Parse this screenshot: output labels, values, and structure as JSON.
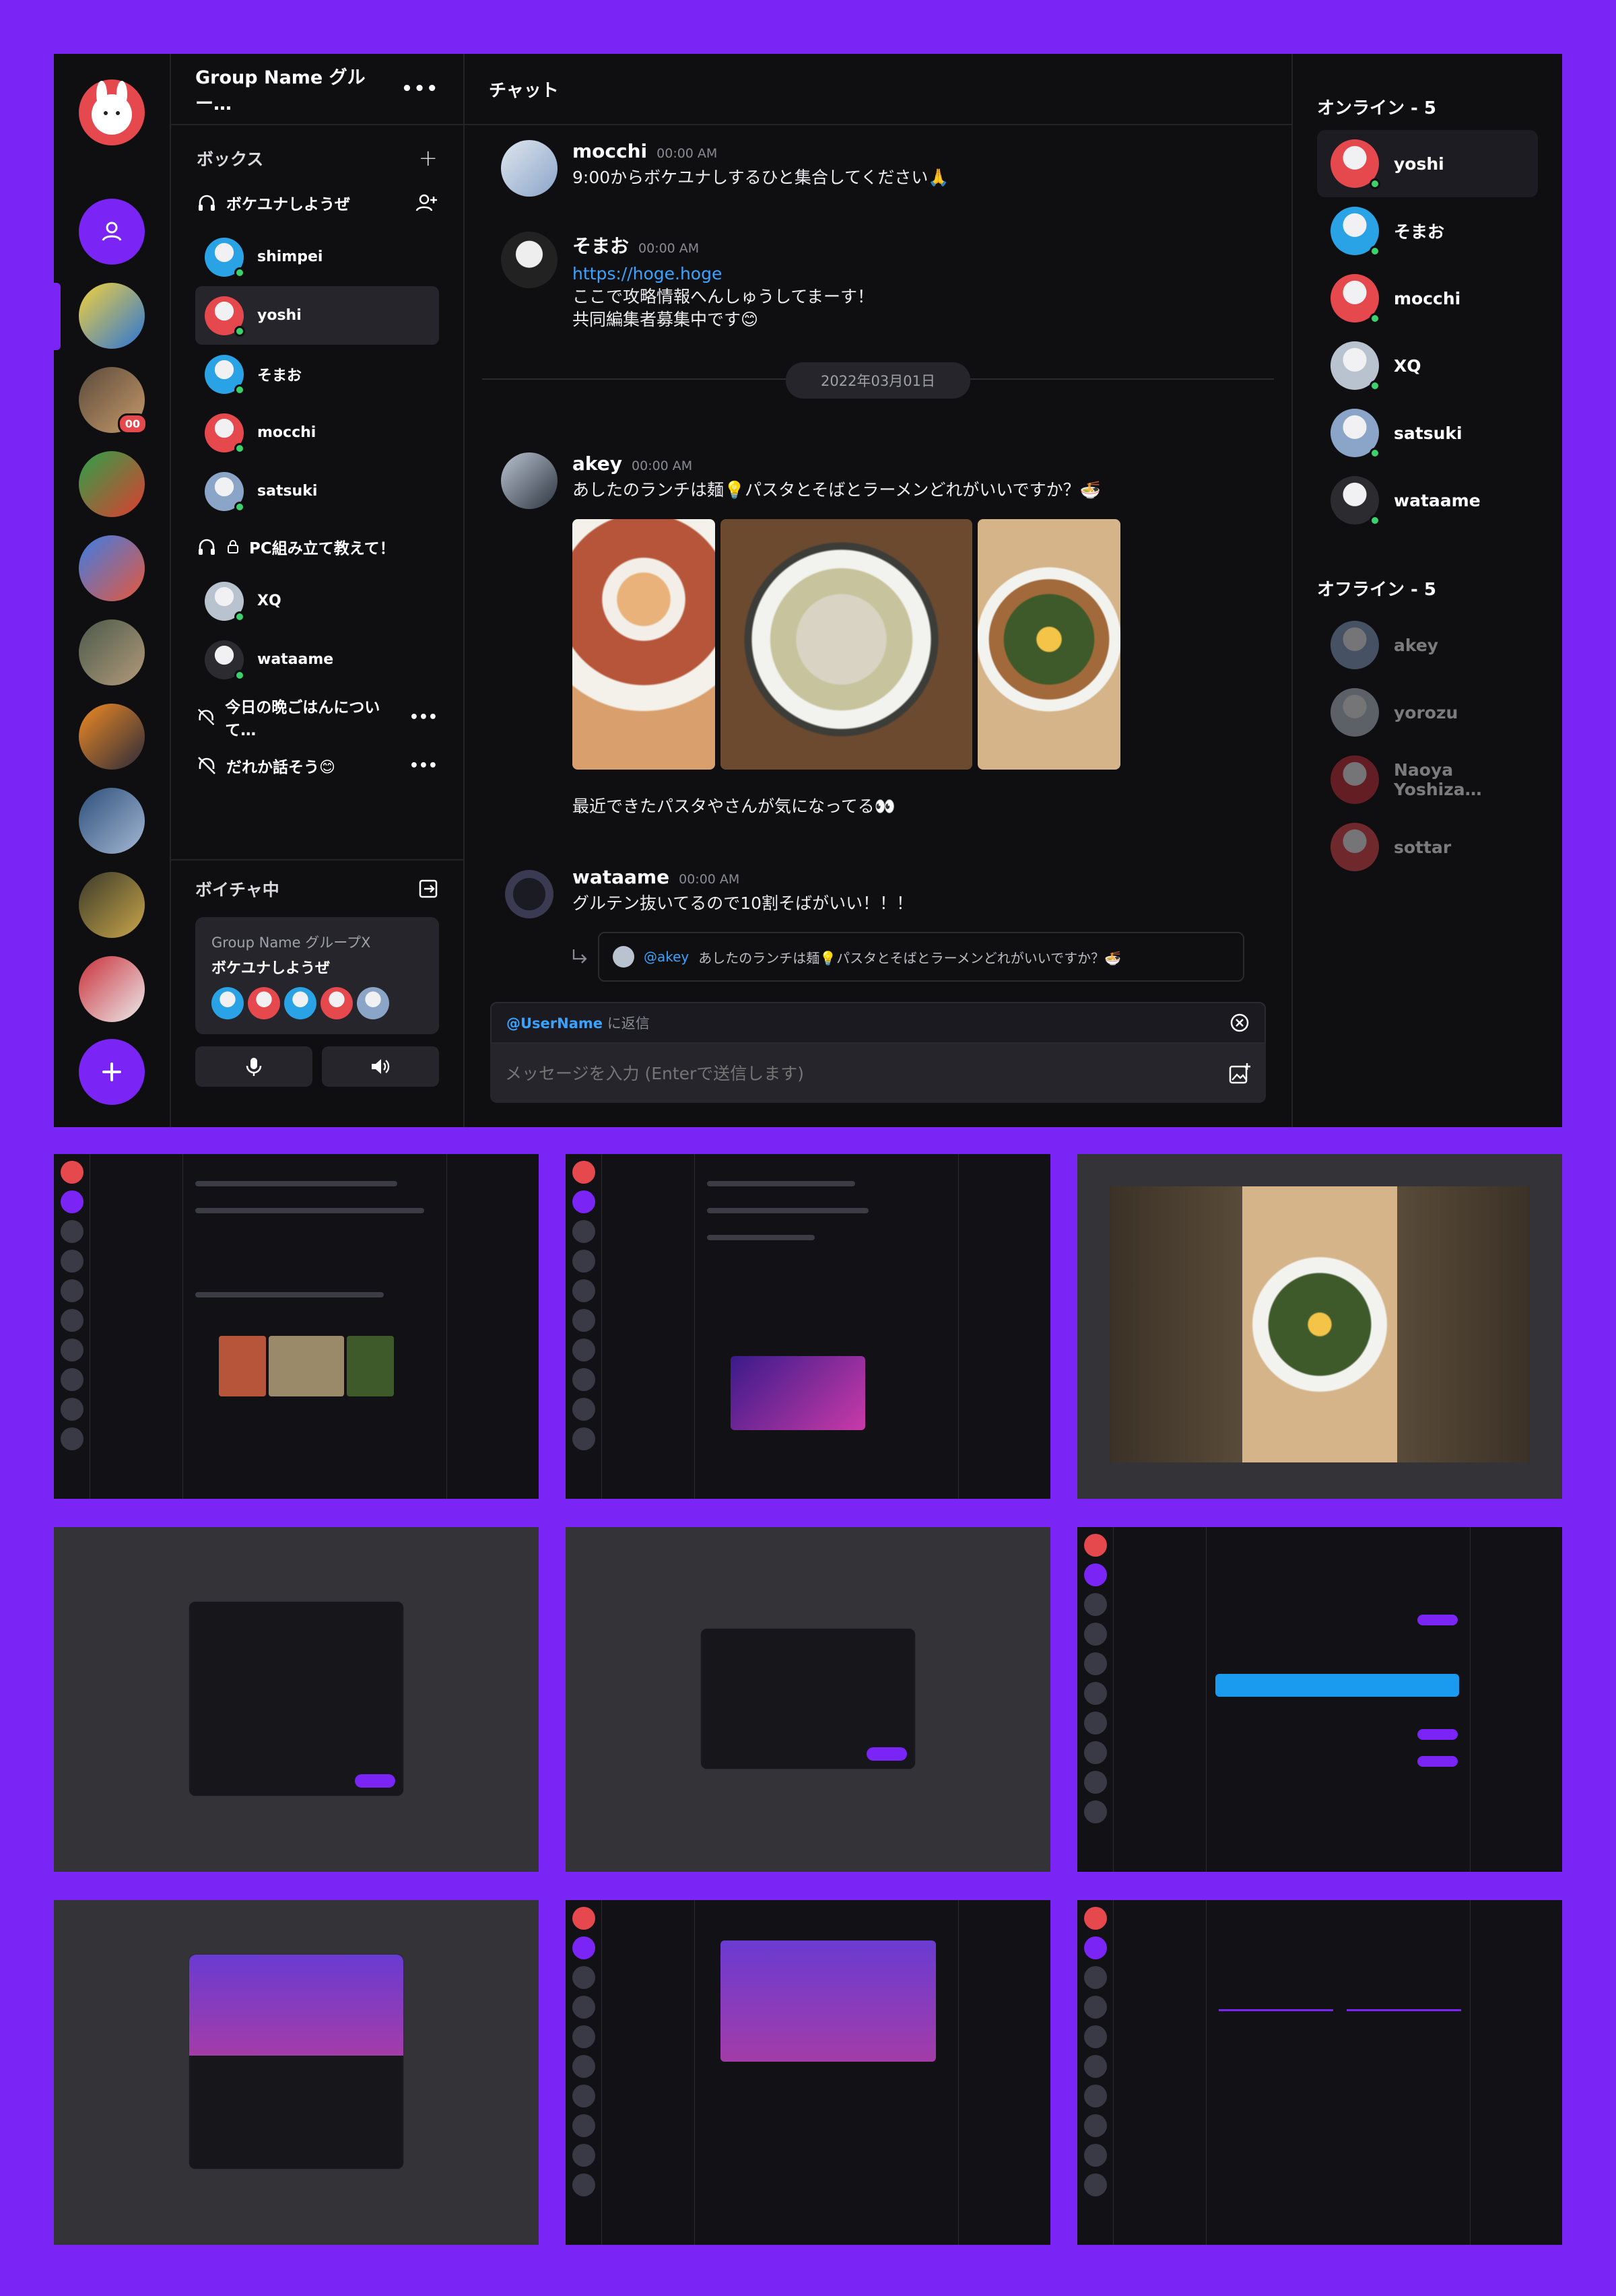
{
  "group": {
    "title": "Group Name グルー…",
    "box_label": "ボックス"
  },
  "voice_channels": [
    {
      "name": "ボケユナしようぜ",
      "members": [
        "shimpei",
        "yoshi",
        "そまお",
        "mocchi",
        "satsuki"
      ]
    },
    {
      "name": "PC組み立て教えて！",
      "members": [
        "XQ",
        "wataame"
      ]
    }
  ],
  "text_channels": [
    "今日の晩ごはんについて…",
    "だれか話そう😊"
  ],
  "voice_status": {
    "label": "ボイチャ中",
    "group": "Group Name グループX",
    "channel": "ボケユナしようぜ"
  },
  "rail": {
    "unread_badge": "00"
  },
  "chat": {
    "title": "チャット",
    "date_divider": "2022年03月01日",
    "messages": [
      {
        "name": "mocchi",
        "time": "00:00 AM",
        "text": "9:00からボケユナしするひと集合してください🙏"
      },
      {
        "name": "そまお",
        "time": "00:00 AM",
        "link": "https://hoge.hoge",
        "text1": "ここで攻略情報へんしゅうしてまーす！",
        "text2": "共同編集者募集中です😊"
      },
      {
        "name": "akey",
        "time": "00:00 AM",
        "text": "あしたのランチは麺💡パスタとそばとラーメンどれがいいですか？🍜",
        "after": "最近できたパスタやさんが気になってる👀"
      },
      {
        "name": "wataame",
        "time": "00:00 AM",
        "text": "グルテン抜いてるので10割そばがいい！！！",
        "reply_user": "@akey",
        "reply_text": "あしたのランチは麺💡パスタとそばとラーメンどれがいいですか？🍜"
      }
    ],
    "reply_to": "@UserName",
    "reply_suffix": "に返信",
    "placeholder": "メッセージを入力 (Enterで送信します)"
  },
  "members": {
    "online_label": "オンライン - 5",
    "online": [
      "yoshi",
      "そまお",
      "mocchi",
      "XQ",
      "satsuki",
      "wataame"
    ],
    "offline_label": "オフライン - 5",
    "offline": [
      "akey",
      "yorozu",
      "Naoya Yoshiza…",
      "sottar"
    ]
  },
  "colors": {
    "accent": "#7a24f6",
    "bg": "#0f0f12",
    "online": "#3bd26d",
    "link": "#3aa3ff",
    "badge": "#e5484d"
  }
}
